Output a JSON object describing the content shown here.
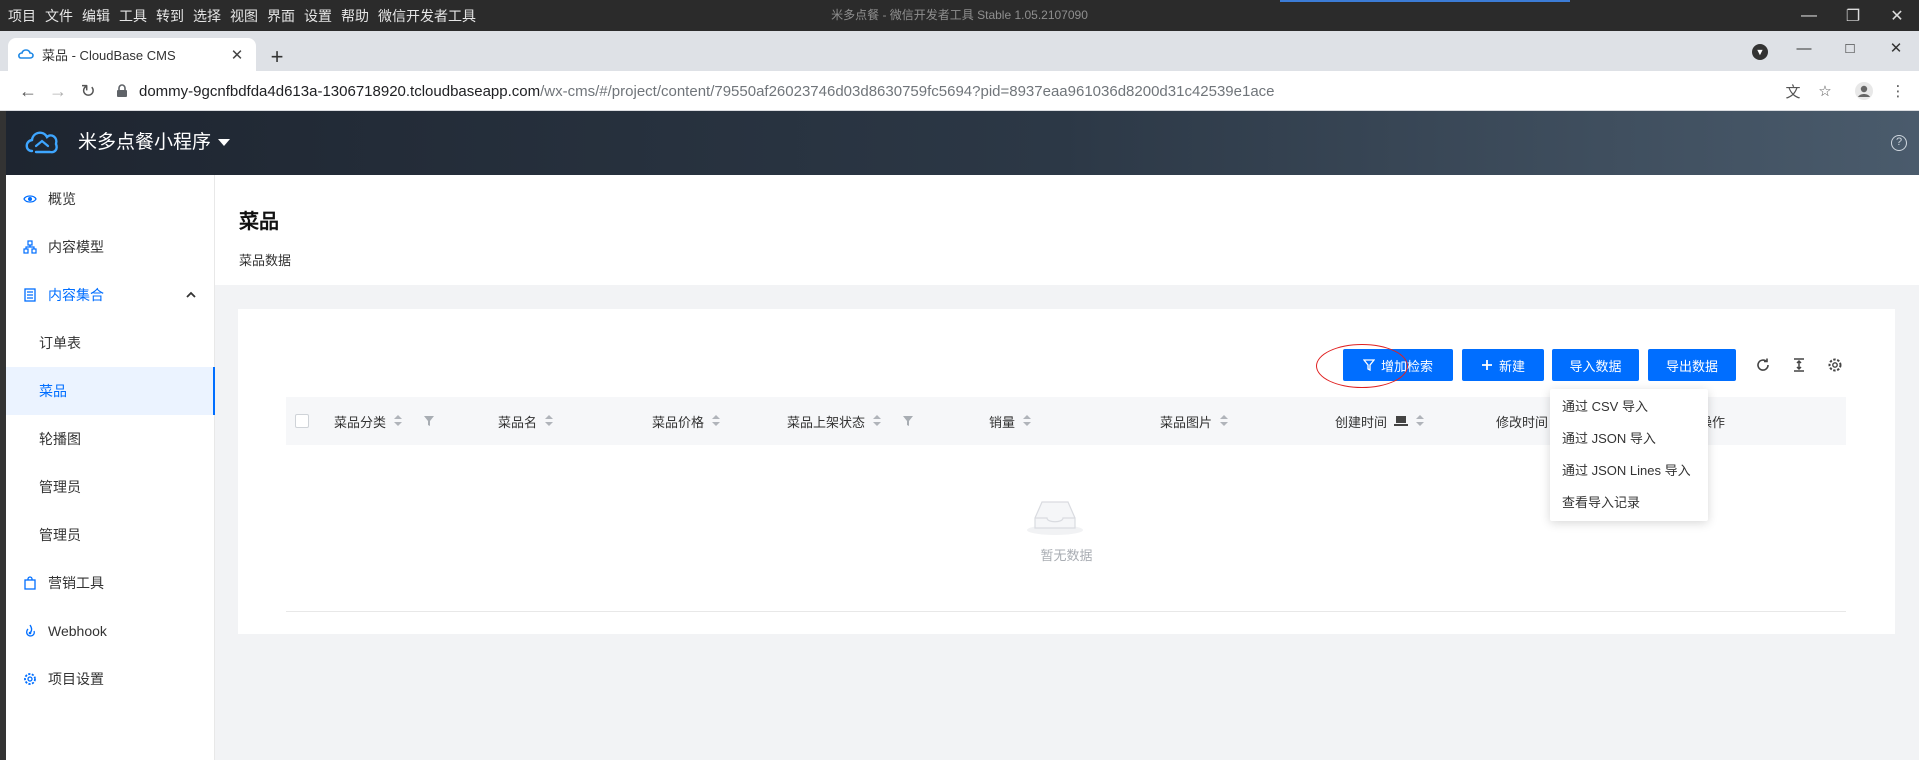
{
  "ide": {
    "menu": [
      "项目",
      "文件",
      "编辑",
      "工具",
      "转到",
      "选择",
      "视图",
      "界面",
      "设置",
      "帮助",
      "微信开发者工具"
    ],
    "title": "米多点餐 - 微信开发者工具 Stable 1.05.2107090"
  },
  "browser": {
    "tab_title": "菜品 - CloudBase CMS",
    "url_host": "dommy-9gcnfbdfda4d613a-1306718920.tcloudbaseapp.com",
    "url_path": "/wx-cms/#/project/content/79550af26023746d03d8630759fc5694?pid=8937eaa961036d8200d31c42539e1ace"
  },
  "app": {
    "name": "米多点餐小程序"
  },
  "sidebar": {
    "items": [
      {
        "label": "概览"
      },
      {
        "label": "内容模型"
      },
      {
        "label": "内容集合"
      },
      {
        "label": "订单表"
      },
      {
        "label": "菜品"
      },
      {
        "label": "轮播图"
      },
      {
        "label": "管理员"
      },
      {
        "label": "管理员"
      },
      {
        "label": "营销工具"
      },
      {
        "label": "Webhook"
      },
      {
        "label": "项目设置"
      }
    ]
  },
  "page": {
    "title": "菜品",
    "description": "菜品数据"
  },
  "toolbar": {
    "filter_label": "增加检索",
    "new_label": "新建",
    "import_label": "导入数据",
    "export_label": "导出数据"
  },
  "table": {
    "columns": [
      "菜品分类",
      "菜品名",
      "菜品价格",
      "菜品上架状态",
      "销量",
      "菜品图片",
      "创建时间",
      "修改时间",
      "操作"
    ],
    "empty_text": "暂无数据"
  },
  "import_menu": {
    "items": [
      "通过 CSV 导入",
      "通过 JSON 导入",
      "通过 JSON Lines 导入",
      "查看导入记录"
    ]
  },
  "colors": {
    "primary": "#006eff",
    "highlight": "#e02020"
  }
}
